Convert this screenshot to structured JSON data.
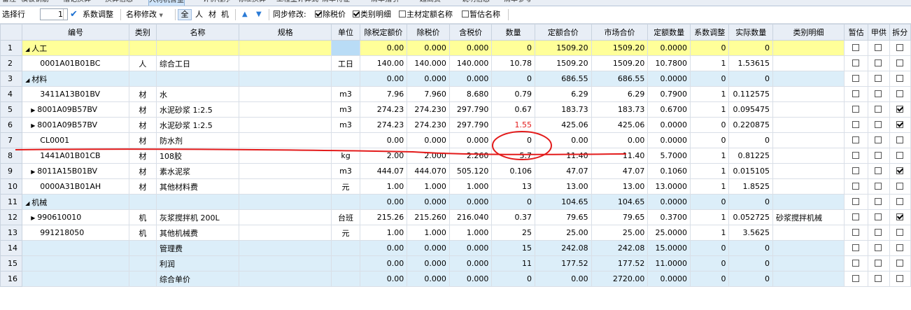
{
  "tabs": [
    "备注",
    "模板钢筋",
    "借记换算",
    "换算信息",
    "人材机含量",
    "计价程序",
    "标准换算",
    "工程量计算式",
    "清单特征",
    "清单指引",
    "超高费",
    "说明信息",
    "清单参考"
  ],
  "toolbar": {
    "select_row_label": "选择行",
    "spin_value": "1",
    "coef_adjust_label": "系数调整",
    "name_modify_label": "名称修改",
    "filter_all": "全",
    "filter_labor": "人",
    "filter_material": "材",
    "filter_machine": "机",
    "sync_label": "同步修改:",
    "opt_excl_tax": "除税价",
    "opt_category_detail": "类别明细",
    "opt_main_material_name": "主材定额名称",
    "opt_provisional_name": "暂估名称"
  },
  "columns": [
    "",
    "编号",
    "类别",
    "名称",
    "规格",
    "单位",
    "除税定额价",
    "除税价",
    "含税价",
    "数量",
    "定额合价",
    "市场合价",
    "定额数量",
    "系数调整",
    "实际数量",
    "类别明细",
    "暂估",
    "甲供",
    "拆分"
  ],
  "rows": [
    {
      "n": "1",
      "code": "人工",
      "type": "",
      "name": "",
      "spec": "",
      "unit": "",
      "p1": "0.00",
      "p2": "0.000",
      "p3": "0.000",
      "qty": "0",
      "t1": "1509.20",
      "t2": "1509.20",
      "dq": "0.0000",
      "coef": "0",
      "aq": "0",
      "cat": "",
      "c1": false,
      "c2": false,
      "c3": false,
      "kind": "sel",
      "expander": "down"
    },
    {
      "n": "2",
      "code": "0001A01B01BC",
      "type": "人",
      "name": "综合工日",
      "spec": "",
      "unit": "工日",
      "p1": "140.00",
      "p2": "140.000",
      "p3": "140.000",
      "qty": "10.78",
      "t1": "1509.20",
      "t2": "1509.20",
      "dq": "10.7800",
      "coef": "1",
      "aq": "1.53615",
      "cat": "",
      "c1": false,
      "c2": false,
      "c3": false,
      "kind": "",
      "expander": ""
    },
    {
      "n": "3",
      "code": "材料",
      "type": "",
      "name": "",
      "spec": "",
      "unit": "",
      "p1": "0.00",
      "p2": "0.000",
      "p3": "0.000",
      "qty": "0",
      "t1": "686.55",
      "t2": "686.55",
      "dq": "0.0000",
      "coef": "0",
      "aq": "0",
      "cat": "",
      "c1": false,
      "c2": false,
      "c3": false,
      "kind": "cat",
      "expander": "down"
    },
    {
      "n": "4",
      "code": "3411A13B01BV",
      "type": "材",
      "name": "水",
      "spec": "",
      "unit": "m3",
      "p1": "7.96",
      "p2": "7.960",
      "p3": "8.680",
      "qty": "0.79",
      "t1": "6.29",
      "t2": "6.29",
      "dq": "0.7900",
      "coef": "1",
      "aq": "0.112575",
      "cat": "",
      "c1": false,
      "c2": false,
      "c3": false,
      "kind": "",
      "expander": ""
    },
    {
      "n": "5",
      "code": "8001A09B57BV",
      "type": "材",
      "name": "水泥砂浆 1:2.5",
      "spec": "",
      "unit": "m3",
      "p1": "274.23",
      "p2": "274.230",
      "p3": "297.790",
      "qty": "0.67",
      "t1": "183.73",
      "t2": "183.73",
      "dq": "0.6700",
      "coef": "1",
      "aq": "0.095475",
      "cat": "",
      "c1": false,
      "c2": false,
      "c3": true,
      "kind": "",
      "expander": "right"
    },
    {
      "n": "6",
      "code": "8001A09B57BV",
      "type": "材",
      "name": "水泥砂浆 1:2.5",
      "spec": "",
      "unit": "m3",
      "p1": "274.23",
      "p2": "274.230",
      "p3": "297.790",
      "qty": "1.55",
      "t1": "425.06",
      "t2": "425.06",
      "dq": "0.0000",
      "coef": "0",
      "aq": "0.220875",
      "cat": "",
      "c1": false,
      "c2": false,
      "c3": true,
      "kind": "",
      "expander": "right",
      "qty_red": true
    },
    {
      "n": "7",
      "code": "CL0001",
      "type": "材",
      "name": "防水剂",
      "spec": "",
      "unit": "",
      "p1": "0.00",
      "p2": "0.000",
      "p3": "0.000",
      "qty": "0",
      "t1": "0.00",
      "t2": "0.00",
      "dq": "0.0000",
      "coef": "0",
      "aq": "0",
      "cat": "",
      "c1": false,
      "c2": false,
      "c3": false,
      "kind": "",
      "expander": ""
    },
    {
      "n": "8",
      "code": "1441A01B01CB",
      "type": "材",
      "name": "108胶",
      "spec": "",
      "unit": "kg",
      "p1": "2.00",
      "p2": "2.000",
      "p3": "2.260",
      "qty": "5.7",
      "t1": "11.40",
      "t2": "11.40",
      "dq": "5.7000",
      "coef": "1",
      "aq": "0.81225",
      "cat": "",
      "c1": false,
      "c2": false,
      "c3": false,
      "kind": "",
      "expander": ""
    },
    {
      "n": "9",
      "code": "8011A15B01BV",
      "type": "材",
      "name": "素水泥浆",
      "spec": "",
      "unit": "m3",
      "p1": "444.07",
      "p2": "444.070",
      "p3": "505.120",
      "qty": "0.106",
      "t1": "47.07",
      "t2": "47.07",
      "dq": "0.1060",
      "coef": "1",
      "aq": "0.015105",
      "cat": "",
      "c1": false,
      "c2": false,
      "c3": true,
      "kind": "",
      "expander": "right"
    },
    {
      "n": "10",
      "code": "0000A31B01AH",
      "type": "材",
      "name": "其他材料费",
      "spec": "",
      "unit": "元",
      "p1": "1.00",
      "p2": "1.000",
      "p3": "1.000",
      "qty": "13",
      "t1": "13.00",
      "t2": "13.00",
      "dq": "13.0000",
      "coef": "1",
      "aq": "1.8525",
      "cat": "",
      "c1": false,
      "c2": false,
      "c3": false,
      "kind": "",
      "expander": ""
    },
    {
      "n": "11",
      "code": "机械",
      "type": "",
      "name": "",
      "spec": "",
      "unit": "",
      "p1": "0.00",
      "p2": "0.000",
      "p3": "0.000",
      "qty": "0",
      "t1": "104.65",
      "t2": "104.65",
      "dq": "0.0000",
      "coef": "0",
      "aq": "0",
      "cat": "",
      "c1": false,
      "c2": false,
      "c3": false,
      "kind": "cat",
      "expander": "down"
    },
    {
      "n": "12",
      "code": "990610010",
      "type": "机",
      "name": "灰浆搅拌机 200L",
      "spec": "",
      "unit": "台班",
      "p1": "215.26",
      "p2": "215.260",
      "p3": "216.040",
      "qty": "0.37",
      "t1": "79.65",
      "t2": "79.65",
      "dq": "0.3700",
      "coef": "1",
      "aq": "0.052725",
      "cat": "砂浆搅拌机械",
      "c1": false,
      "c2": false,
      "c3": true,
      "kind": "",
      "expander": "right"
    },
    {
      "n": "13",
      "code": "991218050",
      "type": "机",
      "name": "其他机械费",
      "spec": "",
      "unit": "元",
      "p1": "1.00",
      "p2": "1.000",
      "p3": "1.000",
      "qty": "25",
      "t1": "25.00",
      "t2": "25.00",
      "dq": "25.0000",
      "coef": "1",
      "aq": "3.5625",
      "cat": "",
      "c1": false,
      "c2": false,
      "c3": false,
      "kind": "",
      "expander": ""
    },
    {
      "n": "14",
      "code": "",
      "type": "",
      "name": "管理费",
      "spec": "",
      "unit": "",
      "p1": "0.00",
      "p2": "0.000",
      "p3": "0.000",
      "qty": "15",
      "t1": "242.08",
      "t2": "242.08",
      "dq": "15.0000",
      "coef": "0",
      "aq": "0",
      "cat": "",
      "c1": false,
      "c2": false,
      "c3": false,
      "kind": "sum",
      "expander": ""
    },
    {
      "n": "15",
      "code": "",
      "type": "",
      "name": "利润",
      "spec": "",
      "unit": "",
      "p1": "0.00",
      "p2": "0.000",
      "p3": "0.000",
      "qty": "11",
      "t1": "177.52",
      "t2": "177.52",
      "dq": "11.0000",
      "coef": "0",
      "aq": "0",
      "cat": "",
      "c1": false,
      "c2": false,
      "c3": false,
      "kind": "sum",
      "expander": ""
    },
    {
      "n": "16",
      "code": "",
      "type": "",
      "name": "综合单价",
      "spec": "",
      "unit": "",
      "p1": "0.00",
      "p2": "0.000",
      "p3": "0.000",
      "qty": "0",
      "t1": "0.00",
      "t2": "2720.00",
      "dq": "0.0000",
      "coef": "0",
      "aq": "0",
      "cat": "",
      "c1": false,
      "c2": false,
      "c3": false,
      "kind": "sum",
      "expander": ""
    }
  ],
  "annotation_color": "#e31b1b"
}
